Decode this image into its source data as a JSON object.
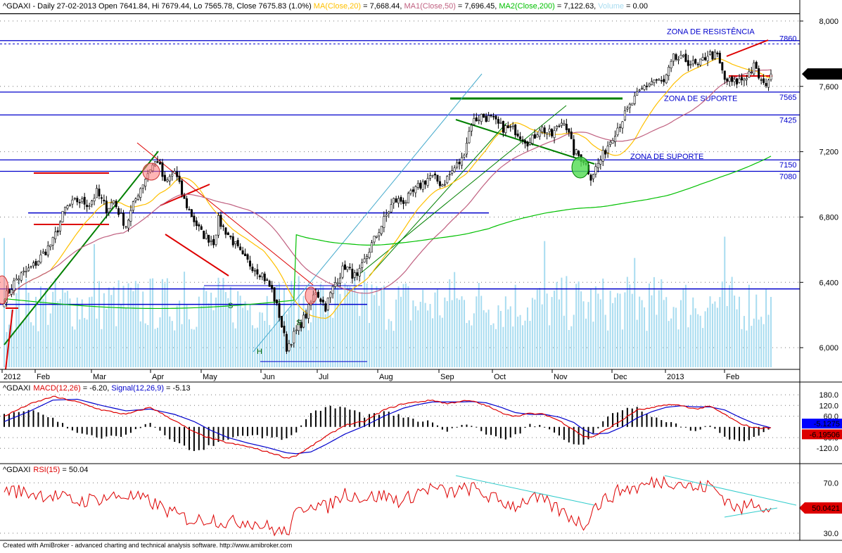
{
  "header": {
    "symbol": "^GDAXI",
    "title_text": " - Daily 27-02-2013 Open 7641.84, Hi 7679.44, Lo 7565.78, Close 7675.83 (1.0%) ",
    "ma20_text": "MA(Close,20)",
    "ma20_value": " = 7,668.44, ",
    "ma50_text": "MA1(Close,50)",
    "ma50_value": " = 7,696.45, ",
    "ma200_text": "MA2(Close,200)",
    "ma200_value": " = 7,122.63, ",
    "volume_text": "Volume",
    "volume_value": " = 0.00"
  },
  "macd_header": {
    "symbol": "^GDAXI",
    "macd_text": "MACD(12,26)",
    "macd_value": " = -6.20, ",
    "signal_text": "Signal(12,26,9)",
    "signal_value": " = -5.13"
  },
  "rsi_header": {
    "symbol": "^GDAXI",
    "rsi_text": "RSI(15)",
    "rsi_value": " = 50.04"
  },
  "footer": "Created with AmiBroker - advanced charting and technical analysis software. http://www.amibroker.com",
  "colors": {
    "ma20": "#ffc000",
    "ma50": "#c06080",
    "ma200": "#00c000",
    "support": "#0000cc",
    "trend_green": "#008000",
    "trend_red": "#dd0000",
    "macd": "#dd0000",
    "signal": "#0000cc",
    "rsi": "#dd0000",
    "volume": "#a8dcf0",
    "price_badge": "#000000",
    "macd_badge": "#0000ff",
    "signal_badge": "#dd0000",
    "rsi_badge": "#dd0000"
  },
  "chart_data": [
    {
      "type": "candlestick",
      "x_axis": {
        "ticks": [
          "2012",
          "Feb",
          "Mar",
          "Apr",
          "May",
          "Jun",
          "Jul",
          "Aug",
          "Sep",
          "Oct",
          "Nov",
          "Dec",
          "2013",
          "Feb"
        ]
      },
      "y_axis": {
        "ticks": [
          "8,000",
          "7,600",
          "7,200",
          "6,800",
          "6,400",
          "6,000"
        ],
        "range": [
          5880,
          8060
        ]
      },
      "last_price_label": "7,675.83",
      "level_labels": [
        {
          "value": 7860,
          "label": "7860"
        },
        {
          "value": 7565,
          "label": "7565"
        },
        {
          "value": 7425,
          "label": "7425"
        },
        {
          "value": 7150,
          "label": "7150"
        },
        {
          "value": 7080,
          "label": "7080"
        }
      ],
      "zones": [
        "ZONA DE RESISTÊNCIA",
        "ZONA DE SUPORTE",
        "ZONA DE SUPORTE"
      ],
      "pattern_labels": [
        "S",
        "S",
        "H"
      ],
      "close_anchors": [
        [
          0,
          6300
        ],
        [
          5,
          6420
        ],
        [
          12,
          6500
        ],
        [
          20,
          6650
        ],
        [
          25,
          6850
        ],
        [
          30,
          6900
        ],
        [
          35,
          6880
        ],
        [
          38,
          6950
        ],
        [
          42,
          6850
        ],
        [
          45,
          6900
        ],
        [
          48,
          6800
        ],
        [
          50,
          6750
        ],
        [
          55,
          6950
        ],
        [
          60,
          7100
        ],
        [
          63,
          7150
        ],
        [
          66,
          7000
        ],
        [
          70,
          7080
        ],
        [
          74,
          6900
        ],
        [
          78,
          6780
        ],
        [
          81,
          6700
        ],
        [
          86,
          6650
        ],
        [
          88,
          6780
        ],
        [
          94,
          6650
        ],
        [
          98,
          6550
        ],
        [
          102,
          6500
        ],
        [
          106,
          6450
        ],
        [
          110,
          6350
        ],
        [
          113,
          6200
        ],
        [
          116,
          6000
        ],
        [
          118,
          6050
        ],
        [
          124,
          6200
        ],
        [
          128,
          6350
        ],
        [
          132,
          6250
        ],
        [
          136,
          6400
        ],
        [
          140,
          6500
        ],
        [
          145,
          6420
        ],
        [
          150,
          6600
        ],
        [
          155,
          6750
        ],
        [
          160,
          6900
        ],
        [
          165,
          6900
        ],
        [
          170,
          6980
        ],
        [
          175,
          7050
        ],
        [
          180,
          7000
        ],
        [
          185,
          7100
        ],
        [
          188,
          7150
        ],
        [
          192,
          7380
        ],
        [
          196,
          7420
        ],
        [
          200,
          7400
        ],
        [
          204,
          7350
        ],
        [
          210,
          7330
        ],
        [
          216,
          7250
        ],
        [
          220,
          7350
        ],
        [
          225,
          7300
        ],
        [
          230,
          7400
        ],
        [
          234,
          7200
        ],
        [
          238,
          7150
        ],
        [
          241,
          7050
        ],
        [
          245,
          7150
        ],
        [
          250,
          7300
        ],
        [
          254,
          7400
        ],
        [
          258,
          7500
        ],
        [
          263,
          7600
        ],
        [
          267,
          7640
        ],
        [
          271,
          7620
        ],
        [
          275,
          7770
        ],
        [
          280,
          7760
        ],
        [
          285,
          7720
        ],
        [
          289,
          7800
        ],
        [
          293,
          7780
        ],
        [
          296,
          7640
        ],
        [
          300,
          7620
        ],
        [
          304,
          7650
        ],
        [
          308,
          7720
        ],
        [
          312,
          7600
        ],
        [
          315,
          7675.83
        ]
      ],
      "ma20": {
        "name": "MA(Close,20)",
        "last": 7668.44
      },
      "ma50": {
        "name": "MA1(Close,50)",
        "last": 7696.45
      },
      "ma200": {
        "name": "MA2(Close,200)",
        "last": 7122.63
      }
    },
    {
      "type": "line",
      "title": "MACD(12,26)",
      "y_axis": {
        "ticks": [
          "180.0",
          "120.0",
          "60.0",
          "-60.0",
          "-120.0"
        ],
        "range": [
          -190,
          200
        ]
      },
      "macd_badge": "-5.1275",
      "signal_badge": "-6.19506",
      "series": [
        {
          "name": "MACD(12,26)",
          "x": [
            0,
            10,
            20,
            30,
            40,
            50,
            60,
            70,
            78,
            85,
            92,
            100,
            108,
            112,
            116,
            120,
            126,
            132,
            140,
            148,
            156,
            164,
            170,
            176,
            182,
            188,
            192,
            198,
            204,
            210,
            216,
            222,
            228,
            234,
            238,
            242,
            248,
            254,
            260,
            266,
            272,
            278,
            284,
            290,
            296,
            302,
            308,
            315
          ],
          "values": [
            60,
            125,
            170,
            140,
            95,
            70,
            110,
            35,
            -30,
            -65,
            -90,
            -110,
            -140,
            -155,
            -175,
            -160,
            -110,
            -55,
            10,
            30,
            95,
            130,
            140,
            150,
            130,
            145,
            145,
            120,
            80,
            60,
            75,
            70,
            35,
            -15,
            -55,
            -55,
            -10,
            40,
            95,
            105,
            125,
            120,
            100,
            115,
            70,
            20,
            -5,
            -6.2
          ]
        },
        {
          "name": "Signal(12,26,9)",
          "x": [
            0,
            10,
            20,
            30,
            40,
            50,
            60,
            70,
            78,
            85,
            92,
            100,
            108,
            112,
            116,
            120,
            126,
            132,
            140,
            148,
            156,
            164,
            170,
            176,
            182,
            188,
            192,
            198,
            204,
            210,
            216,
            222,
            228,
            234,
            238,
            242,
            248,
            254,
            260,
            266,
            272,
            278,
            284,
            290,
            296,
            302,
            308,
            315
          ],
          "values": [
            30,
            85,
            150,
            155,
            120,
            90,
            100,
            70,
            30,
            -20,
            -60,
            -90,
            -115,
            -130,
            -145,
            -150,
            -140,
            -100,
            -40,
            5,
            60,
            105,
            125,
            140,
            140,
            140,
            142,
            135,
            110,
            80,
            70,
            70,
            55,
            25,
            -15,
            -40,
            -35,
            0,
            50,
            85,
            110,
            118,
            112,
            112,
            95,
            55,
            20,
            -5.13
          ]
        }
      ]
    },
    {
      "type": "line",
      "title": "RSI(15)",
      "y_axis": {
        "ticks": [
          "70.0",
          "30.0"
        ],
        "range": [
          26,
          78
        ]
      },
      "badge": "50.0421",
      "series": [
        {
          "name": "RSI(15)",
          "x": [
            0,
            10,
            20,
            30,
            40,
            50,
            60,
            70,
            78,
            85,
            92,
            100,
            108,
            112,
            116,
            120,
            126,
            132,
            140,
            148,
            156,
            164,
            170,
            176,
            182,
            188,
            192,
            198,
            204,
            210,
            216,
            222,
            228,
            234,
            238,
            242,
            248,
            254,
            260,
            266,
            272,
            278,
            284,
            290,
            296,
            302,
            308,
            315
          ],
          "values": [
            65,
            62,
            60,
            55,
            58,
            60,
            55,
            45,
            40,
            42,
            38,
            40,
            35,
            32,
            30,
            45,
            55,
            50,
            62,
            58,
            60,
            55,
            63,
            66,
            62,
            64,
            66,
            60,
            55,
            52,
            58,
            55,
            48,
            42,
            36,
            50,
            58,
            65,
            66,
            70,
            72,
            70,
            65,
            68,
            58,
            48,
            55,
            50.04
          ]
        }
      ]
    }
  ]
}
